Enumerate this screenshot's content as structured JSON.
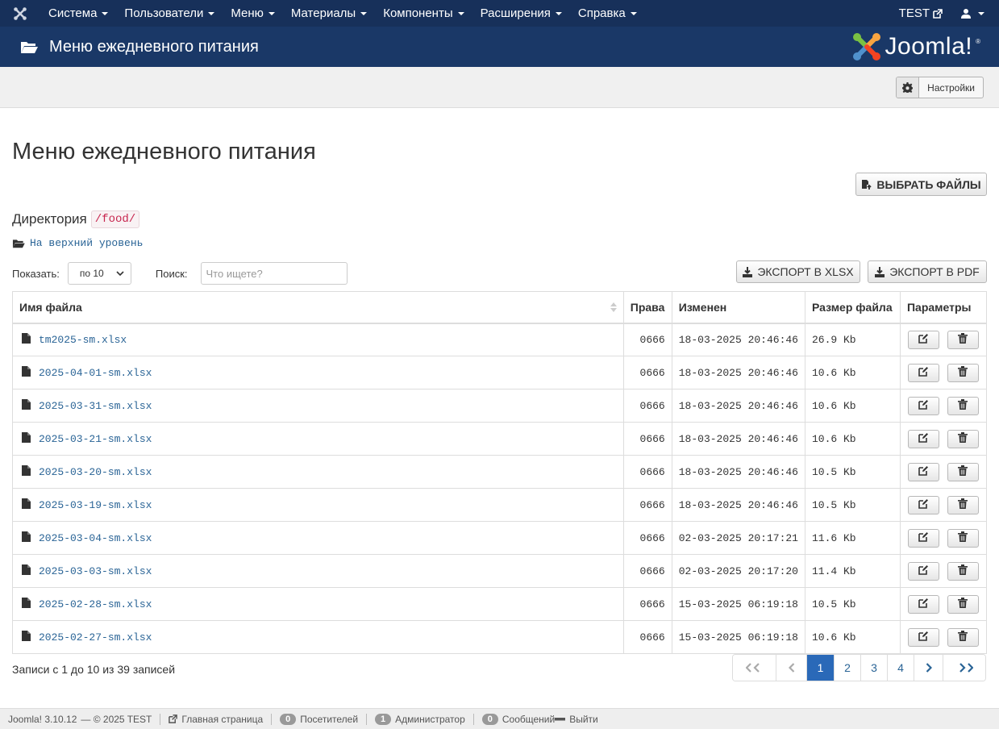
{
  "navbar": {
    "menu": [
      {
        "label": "Система"
      },
      {
        "label": "Пользователи"
      },
      {
        "label": "Меню"
      },
      {
        "label": "Материалы"
      },
      {
        "label": "Компоненты"
      },
      {
        "label": "Расширения"
      },
      {
        "label": "Справка"
      }
    ],
    "site_label": "TEST"
  },
  "header": {
    "title": "Меню ежедневного питания",
    "brand": "Joomla!",
    "brand_mark": "®"
  },
  "toolbar": {
    "settings_label": "Настройки"
  },
  "main": {
    "title": "Меню ежедневного питания",
    "choose_files_label": "ВЫБРАТЬ ФАЙЛЫ",
    "directory_label": "Директория",
    "directory_path": "/food/",
    "up_level_label": "На верхний уровень",
    "show_label": "Показать:",
    "show_value": "по 10",
    "search_label": "Поиск:",
    "search_placeholder": "Что ищете?",
    "export_xlsx_label": "ЭКСПОРТ В XLSX",
    "export_pdf_label": "ЭКСПОРТ В PDF"
  },
  "table": {
    "columns": [
      "Имя файла",
      "Права",
      "Изменен",
      "Размер файла",
      "Параметры"
    ],
    "rows": [
      {
        "name": "tm2025-sm.xlsx",
        "perm": "0666",
        "modified": "18-03-2025 20:46:46",
        "size": "26.9 Kb"
      },
      {
        "name": "2025-04-01-sm.xlsx",
        "perm": "0666",
        "modified": "18-03-2025 20:46:46",
        "size": "10.6 Kb"
      },
      {
        "name": "2025-03-31-sm.xlsx",
        "perm": "0666",
        "modified": "18-03-2025 20:46:46",
        "size": "10.6 Kb"
      },
      {
        "name": "2025-03-21-sm.xlsx",
        "perm": "0666",
        "modified": "18-03-2025 20:46:46",
        "size": "10.6 Kb"
      },
      {
        "name": "2025-03-20-sm.xlsx",
        "perm": "0666",
        "modified": "18-03-2025 20:46:46",
        "size": "10.5 Kb"
      },
      {
        "name": "2025-03-19-sm.xlsx",
        "perm": "0666",
        "modified": "18-03-2025 20:46:46",
        "size": "10.5 Kb"
      },
      {
        "name": "2025-03-04-sm.xlsx",
        "perm": "0666",
        "modified": "02-03-2025 20:17:21",
        "size": "11.6 Kb"
      },
      {
        "name": "2025-03-03-sm.xlsx",
        "perm": "0666",
        "modified": "02-03-2025 20:17:20",
        "size": "11.4 Kb"
      },
      {
        "name": "2025-02-28-sm.xlsx",
        "perm": "0666",
        "modified": "15-03-2025 06:19:18",
        "size": "10.5 Kb"
      },
      {
        "name": "2025-02-27-sm.xlsx",
        "perm": "0666",
        "modified": "15-03-2025 06:19:18",
        "size": "10.6 Kb"
      }
    ]
  },
  "records_info": "Записи с 1 до 10 из 39 записей",
  "pagination": {
    "pages": [
      "1",
      "2",
      "3",
      "4"
    ],
    "current": "1"
  },
  "statusbar": {
    "version": "Joomla! 3.10.12",
    "copyright": "— © 2025 TEST",
    "home_label": "Главная страница",
    "visitors_count": "0",
    "visitors_label": "Посетителей",
    "admins_count": "1",
    "admins_label": "Администратор",
    "messages_count": "0",
    "messages_label": "Сообщений",
    "logout_label": "Выйти"
  },
  "colors": {
    "navbar": "#17305a",
    "header": "#1a3867",
    "link": "#2a6496",
    "active_page": "#2a69b8"
  }
}
